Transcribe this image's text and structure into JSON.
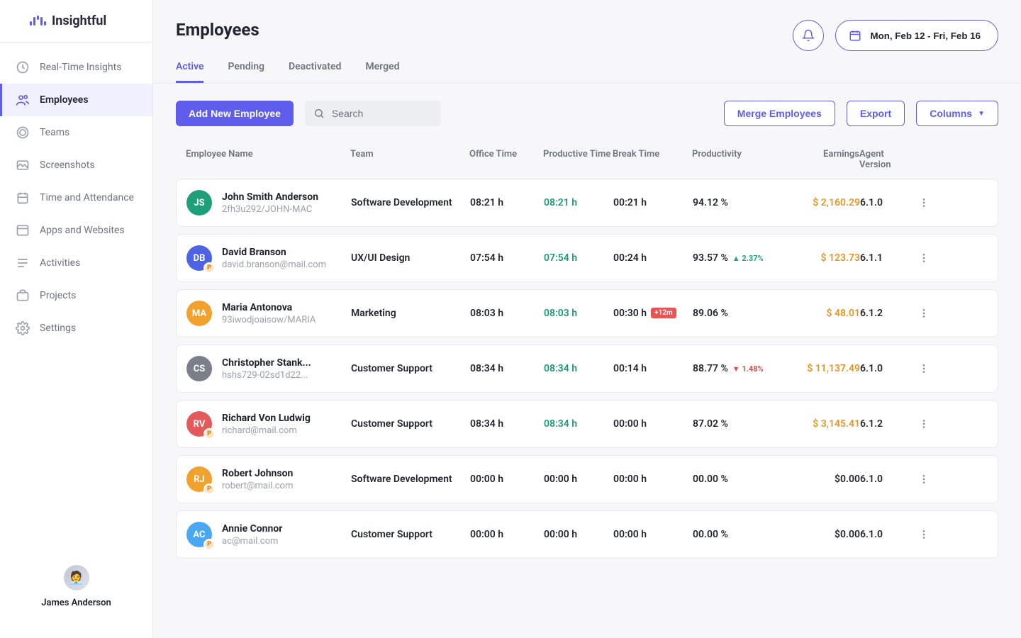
{
  "brand": "Insightful",
  "page_title": "Employees",
  "date_range": "Mon, Feb 12 - Fri,  Feb 16",
  "profile_name": "James Anderson",
  "sidebar": [
    {
      "label": "Real-Time Insights"
    },
    {
      "label": "Employees",
      "active": true
    },
    {
      "label": "Teams"
    },
    {
      "label": "Screenshots"
    },
    {
      "label": "Time and Attendance"
    },
    {
      "label": "Apps and Websites"
    },
    {
      "label": "Activities"
    },
    {
      "label": "Projects"
    },
    {
      "label": "Settings"
    }
  ],
  "tabs": [
    "Active",
    "Pending",
    "Deactivated",
    "Merged"
  ],
  "active_tab": "Active",
  "buttons": {
    "add": "Add New Employee",
    "merge": "Merge Employees",
    "export": "Export",
    "columns": "Columns"
  },
  "search_placeholder": "Search",
  "columns": [
    "Employee Name",
    "Team",
    "Office Time",
    "Productive Time",
    "Break Time",
    "Productivity",
    "Earnings",
    "Agent Version"
  ],
  "rows": [
    {
      "initials": "JS",
      "av_color": "#1f9e7a",
      "name": "John Smith Anderson",
      "sub": "2fh3u292/JOHN-MAC",
      "team": "Software Development",
      "office": "08:21 h",
      "productive": "08:21 h",
      "break": "00:21 h",
      "productivity": "94.12 %",
      "delta": "",
      "delta_dir": "",
      "earnings": "$ 2,160.29",
      "earnings_color": "amber",
      "version": "6.1.0",
      "badge": false
    },
    {
      "initials": "DB",
      "av_color": "#4e63e4",
      "name": "David Branson",
      "sub": "david.branson@mail.com",
      "team": "UX/UI Design",
      "office": "07:54 h",
      "productive": "07:54 h",
      "break": "00:24 h",
      "productivity": "93.57 %",
      "delta": "2.37%",
      "delta_dir": "up",
      "earnings": "$ 123.73",
      "earnings_color": "amber",
      "version": "6.1.1",
      "badge": true
    },
    {
      "initials": "MA",
      "av_color": "#f0a12e",
      "name": "Maria Antonova",
      "sub": "93iwodjoaisow/MARIA",
      "team": "Marketing",
      "office": "08:03 h",
      "productive": "08:03 h",
      "break": "00:30 h",
      "break_pill": "+12m",
      "productivity": "89.06 %",
      "delta": "",
      "delta_dir": "",
      "earnings": "$ 48.01",
      "earnings_color": "amber",
      "version": "6.1.2",
      "badge": false
    },
    {
      "initials": "CS",
      "av_color": "#7a7f8a",
      "name": "Christopher Stank...",
      "sub": "hshs729-02sd1d22...",
      "team": "Customer Support",
      "office": "08:34 h",
      "productive": "08:34 h",
      "break": "00:14 h",
      "productivity": "88.77 %",
      "delta": "1.48%",
      "delta_dir": "down",
      "earnings": "$ 11,137.49",
      "earnings_color": "amber",
      "version": "6.1.0",
      "badge": false
    },
    {
      "initials": "RV",
      "av_color": "#e45a5a",
      "name": "Richard Von Ludwig",
      "sub": "richard@mail.com",
      "team": "Customer Support",
      "office": "08:34 h",
      "productive": "08:34 h",
      "break": "00:00 h",
      "productivity": "87.02 %",
      "delta": "",
      "delta_dir": "",
      "earnings": "$ 3,145.41",
      "earnings_color": "amber",
      "version": "6.1.2",
      "badge": true
    },
    {
      "initials": "RJ",
      "av_color": "#f0a12e",
      "name": "Robert Johnson",
      "sub": "robert@mail.com",
      "team": "Software Development",
      "office": "00:00 h",
      "productive": "00:00 h",
      "prod_color": "",
      "break": "00:00 h",
      "productivity": "00.00 %",
      "delta": "",
      "delta_dir": "",
      "earnings": "$0.00",
      "earnings_color": "",
      "version": "6.1.0",
      "badge": true
    },
    {
      "initials": "AC",
      "av_color": "#4aa8f3",
      "name": "Annie Connor",
      "sub": "ac@mail.com",
      "team": "Customer Support",
      "office": "00:00 h",
      "productive": "00:00 h",
      "prod_color": "",
      "break": "00:00 h",
      "productivity": "00.00 %",
      "delta": "",
      "delta_dir": "",
      "earnings": "$0.00",
      "earnings_color": "",
      "version": "6.1.0",
      "badge": true
    }
  ]
}
